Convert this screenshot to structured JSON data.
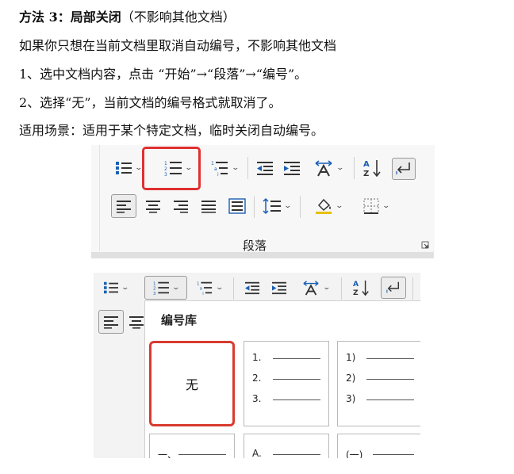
{
  "doc": {
    "heading_strong": "方法 3：局部关闭",
    "heading_note": "（不影响其他文档）",
    "line1": "如果你只想在当前文档里取消自动编号，不影响其他文档",
    "line2": "1、选中文档内容，点击 “开始”→“段落”→“编号”。",
    "line3": "2、选择“无”，当前文档的编号格式就取消了。",
    "line4": "适用场景：适用于某个特定文档，临时关闭自动编号。"
  },
  "ribbon": {
    "group_label": "段落",
    "icons": [
      "bullets-icon",
      "numbering-icon",
      "multilevel-list-icon",
      "decrease-indent-icon",
      "increase-indent-icon",
      "text-direction-icon",
      "sort-icon",
      "show-marks-icon",
      "align-left-icon",
      "align-center-icon",
      "align-right-icon",
      "justify-icon",
      "distributed-icon",
      "line-spacing-icon",
      "shading-icon",
      "borders-icon",
      "dialog-launcher-icon"
    ],
    "highlight_color": "#e03030"
  },
  "numbering_library": {
    "title": "编号库",
    "none_label": "无",
    "formats": [
      {
        "items": [
          "1.",
          "2.",
          "3."
        ]
      },
      {
        "items": [
          "1)",
          "2)",
          "3)"
        ]
      }
    ],
    "partial_row": [
      "一、",
      "A.",
      "(一)"
    ],
    "selected_border_color": "#d93a2f"
  }
}
